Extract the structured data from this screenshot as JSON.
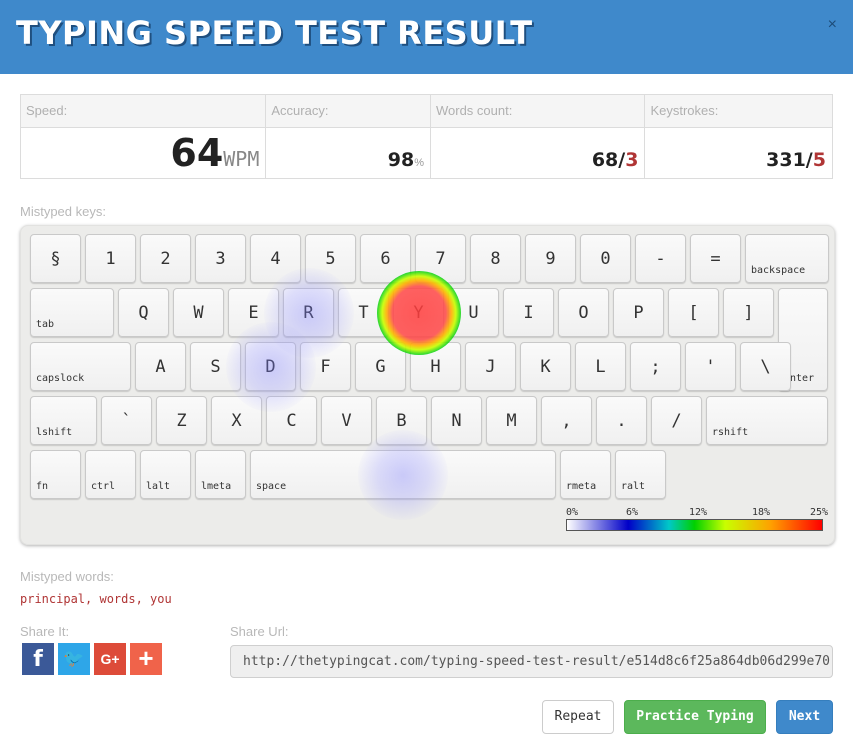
{
  "header": {
    "title": "TYPING SPEED TEST RESULT",
    "close": "×"
  },
  "stats": {
    "speed": {
      "label": "Speed:",
      "value": "64",
      "unit": "WPM"
    },
    "accuracy": {
      "label": "Accuracy:",
      "value": "98",
      "unit": "%"
    },
    "words": {
      "label": "Words count:",
      "value": "68/",
      "errors": "3"
    },
    "keystrokes": {
      "label": "Keystrokes:",
      "value": "331/",
      "errors": "5"
    }
  },
  "mistyped_keys": {
    "label": "Mistyped keys:",
    "rows": [
      [
        "§",
        "1",
        "2",
        "3",
        "4",
        "5",
        "6",
        "7",
        "8",
        "9",
        "0",
        "-",
        "=",
        "backspace"
      ],
      [
        "tab",
        "Q",
        "W",
        "E",
        "R",
        "T",
        "Y",
        "U",
        "I",
        "O",
        "P",
        "[",
        "]",
        "enter"
      ],
      [
        "capslock",
        "A",
        "S",
        "D",
        "F",
        "G",
        "H",
        "J",
        "K",
        "L",
        ";",
        "'",
        "\\"
      ],
      [
        "lshift",
        "`",
        "Z",
        "X",
        "C",
        "V",
        "B",
        "N",
        "M",
        ",",
        ".",
        "/",
        "rshift"
      ],
      [
        "fn",
        "ctrl",
        "lalt",
        "lmeta",
        "space",
        "rmeta",
        "ralt"
      ]
    ],
    "error_rates": {
      "Y": 0.25,
      "R": 0.04,
      "D": 0.04,
      "space": 0.02
    },
    "legend": [
      "0%",
      "6%",
      "12%",
      "18%",
      "25%"
    ]
  },
  "mistyped_words": {
    "label": "Mistyped words:",
    "value": "principal, words, you"
  },
  "share": {
    "label": "Share It:",
    "url_label": "Share Url:",
    "url": "http://thetypingcat.com/typing-speed-test-result/e514d8c6f25a864db06d299e70",
    "buttons": [
      {
        "glyph": "f",
        "color": "#3b5998"
      },
      {
        "glyph": "🐦",
        "color": "#2ea6e8"
      },
      {
        "glyph": "G+",
        "color": "#dd4b39"
      },
      {
        "glyph": "+",
        "color": "#f0634a"
      }
    ]
  },
  "actions": {
    "repeat": "Repeat",
    "practice": "Practice Typing",
    "next": "Next"
  },
  "colors": {
    "header": "#3f89cb",
    "error": "#b03535",
    "practice": "#5cb85c",
    "next": "#3f89cb"
  }
}
